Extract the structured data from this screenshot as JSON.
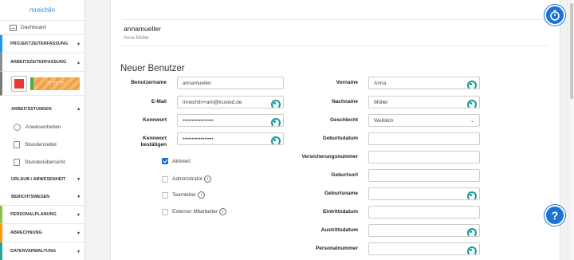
{
  "sidebar": {
    "brand": "mreichlin",
    "dashboard": "Dashboard",
    "timer_text": "?? ??:??",
    "sections": [
      {
        "label": "PROJEKTZEITERFASSUNG",
        "color": "#2196f3"
      },
      {
        "label": "ARBEITSZEITERFASSUNG",
        "color": "#8e8e8e"
      },
      {
        "label": "PERSONALPLANUNG",
        "color": "#8bc34a"
      },
      {
        "label": "ABRECHNUNG",
        "color": "#ff9800"
      },
      {
        "label": "DATENVERWALTUNG",
        "color": "#26a69a"
      }
    ],
    "arbeitsstunden": {
      "label": "ARBEITSSTUNDEN",
      "items": [
        "Anwesenheiten",
        "Stundenzettel",
        "Stundenübersicht"
      ]
    },
    "urlaub": "URLAUB / ABWESENHEIT",
    "berichtswesen": "BERICHTSWESEN"
  },
  "header": {
    "username": "annamueller",
    "fullname": "Anna Müller"
  },
  "form": {
    "title": "Neuer Benutzer",
    "left": {
      "benutzername": {
        "label": "Benutzername",
        "value": "annamueller"
      },
      "email": {
        "label": "E-Mail",
        "value": "mreichlin+am@trusted.de"
      },
      "kennwort": {
        "label": "Kennwort",
        "value": "•••••••••••••••••"
      },
      "kennwort2": {
        "label_1": "Kennwort",
        "label_2": "bestätigen",
        "value": "•••••••••••••••••"
      }
    },
    "checkboxes": {
      "aktiviert": "Aktiviert",
      "administrator": "Administrator",
      "teamleiter": "Teamleiter",
      "extern": "Externer Mitarbeiter"
    },
    "right": {
      "vorname": {
        "label": "Vorname",
        "value": "Anna"
      },
      "nachname": {
        "label": "Nachname",
        "value": "Müller"
      },
      "geschlecht": {
        "label": "Geschlecht",
        "value": "Weiblich"
      },
      "geburtsdatum": {
        "label": "Geburtsdatum",
        "value": ""
      },
      "versicherungsnummer": {
        "label": "Versicherungsnummer",
        "value": ""
      },
      "geburtsort": {
        "label": "Geburtsort",
        "value": ""
      },
      "geburtsname": {
        "label": "Geburtsname",
        "value": ""
      },
      "eintrittsdatum": {
        "label": "Eintrittsdatum",
        "value": ""
      },
      "austrittsdatum": {
        "label": "Austrittsdatum",
        "value": ""
      },
      "personalnummer": {
        "label": "Personalnummer",
        "value": ""
      }
    }
  },
  "fab": {
    "timer_icon": "stopwatch-icon",
    "help_icon": "?"
  },
  "colors": {
    "accent": "#1a73d6",
    "brand": "#2f8fd8",
    "stop": "#e53935",
    "timer_bar": "#f0a04a",
    "keypass": "#0f9a96"
  }
}
